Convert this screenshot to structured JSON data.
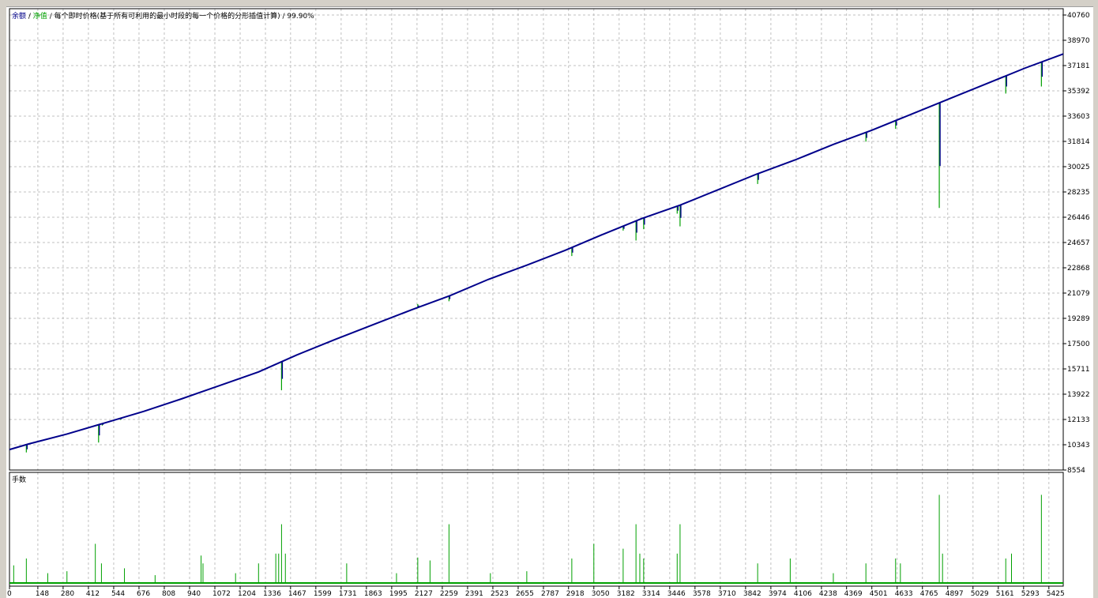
{
  "colors": {
    "balance": "#00008b",
    "equity": "#00a000",
    "grid": "#c0c0c0",
    "background": "#ffffff",
    "frame": "#000000"
  },
  "chart_data": [
    {
      "type": "line",
      "legend": {
        "balance_label": "余额",
        "equity_label": "净值",
        "description": "每个即时价格(基于所有可利用的最小时段的每一个价格的分形插值计算)",
        "quality": "99.90%",
        "placement": "top-left"
      },
      "grid": true,
      "xlim": [
        0,
        5500
      ],
      "ylim": [
        8554,
        40760
      ],
      "x_ticks": [
        0,
        148,
        280,
        412,
        544,
        676,
        808,
        940,
        1072,
        1204,
        1336,
        1467,
        1599,
        1731,
        1863,
        1995,
        2127,
        2259,
        2391,
        2523,
        2655,
        2787,
        2918,
        3050,
        3182,
        3314,
        3446,
        3578,
        3710,
        3842,
        3974,
        4106,
        4238,
        4369,
        4501,
        4633,
        4765,
        4897,
        5029,
        5161,
        5293,
        5425
      ],
      "y_ticks": [
        40760,
        38970,
        37181,
        35392,
        33603,
        31814,
        30025,
        28235,
        26446,
        24657,
        22868,
        21079,
        19289,
        17500,
        15711,
        13922,
        12133,
        10343,
        8554
      ],
      "series": [
        {
          "name": "余额",
          "x": [
            0,
            100,
            300,
            500,
            700,
            900,
            1100,
            1300,
            1500,
            1700,
            1900,
            2100,
            2300,
            2500,
            2700,
            2900,
            3100,
            3300,
            3500,
            3700,
            3900,
            4100,
            4300,
            4500,
            4700,
            4900,
            5100,
            5300,
            5500
          ],
          "values": [
            10000,
            10400,
            11100,
            11900,
            12700,
            13600,
            14550,
            15500,
            16700,
            17800,
            18850,
            19900,
            20900,
            22050,
            23050,
            24100,
            25250,
            26350,
            27300,
            28400,
            29500,
            30500,
            31600,
            32600,
            33700,
            34800,
            35900,
            37000,
            38000
          ]
        },
        {
          "name": "净值",
          "drawdowns": [
            {
              "x": 88,
              "low": 9800
            },
            {
              "x": 465,
              "low": 10500
            },
            {
              "x": 484,
              "low": 11700
            },
            {
              "x": 580,
              "low": 12100
            },
            {
              "x": 1005,
              "low": 14100
            },
            {
              "x": 1395,
              "low": 16100
            },
            {
              "x": 1420,
              "low": 14200
            },
            {
              "x": 2131,
              "low": 20300
            },
            {
              "x": 2294,
              "low": 20500
            },
            {
              "x": 2935,
              "low": 23700
            },
            {
              "x": 3203,
              "low": 25500
            },
            {
              "x": 3270,
              "low": 24800
            },
            {
              "x": 3310,
              "low": 25600
            },
            {
              "x": 3485,
              "low": 26700
            },
            {
              "x": 3500,
              "low": 25800
            },
            {
              "x": 3905,
              "low": 28800
            },
            {
              "x": 4470,
              "low": 31800
            },
            {
              "x": 4625,
              "low": 32700
            },
            {
              "x": 4853,
              "low": 27100
            },
            {
              "x": 5200,
              "low": 35200
            },
            {
              "x": 5386,
              "low": 35700
            }
          ]
        }
      ]
    },
    {
      "type": "bar",
      "title": "手数",
      "spikes": [
        {
          "x": 22,
          "v": 0.18
        },
        {
          "x": 88,
          "v": 0.25
        },
        {
          "x": 200,
          "v": 0.1
        },
        {
          "x": 300,
          "v": 0.12
        },
        {
          "x": 448,
          "v": 0.4
        },
        {
          "x": 480,
          "v": 0.2
        },
        {
          "x": 600,
          "v": 0.15
        },
        {
          "x": 760,
          "v": 0.08
        },
        {
          "x": 1000,
          "v": 0.28
        },
        {
          "x": 1010,
          "v": 0.2
        },
        {
          "x": 1180,
          "v": 0.1
        },
        {
          "x": 1300,
          "v": 0.2
        },
        {
          "x": 1390,
          "v": 0.3
        },
        {
          "x": 1405,
          "v": 0.3
        },
        {
          "x": 1420,
          "v": 0.6
        },
        {
          "x": 1440,
          "v": 0.3
        },
        {
          "x": 1760,
          "v": 0.2
        },
        {
          "x": 2020,
          "v": 0.1
        },
        {
          "x": 2131,
          "v": 0.26
        },
        {
          "x": 2195,
          "v": 0.23
        },
        {
          "x": 2294,
          "v": 0.6
        },
        {
          "x": 2510,
          "v": 0.1
        },
        {
          "x": 2700,
          "v": 0.12
        },
        {
          "x": 2935,
          "v": 0.25
        },
        {
          "x": 3050,
          "v": 0.4
        },
        {
          "x": 3203,
          "v": 0.35
        },
        {
          "x": 3270,
          "v": 0.6
        },
        {
          "x": 3290,
          "v": 0.3
        },
        {
          "x": 3310,
          "v": 0.25
        },
        {
          "x": 3485,
          "v": 0.3
        },
        {
          "x": 3500,
          "v": 0.6
        },
        {
          "x": 3905,
          "v": 0.2
        },
        {
          "x": 4075,
          "v": 0.25
        },
        {
          "x": 4300,
          "v": 0.1
        },
        {
          "x": 4470,
          "v": 0.2
        },
        {
          "x": 4625,
          "v": 0.25
        },
        {
          "x": 4650,
          "v": 0.2
        },
        {
          "x": 4853,
          "v": 0.9
        },
        {
          "x": 4870,
          "v": 0.3
        },
        {
          "x": 5200,
          "v": 0.25
        },
        {
          "x": 5230,
          "v": 0.3
        },
        {
          "x": 5386,
          "v": 0.9
        }
      ]
    }
  ]
}
